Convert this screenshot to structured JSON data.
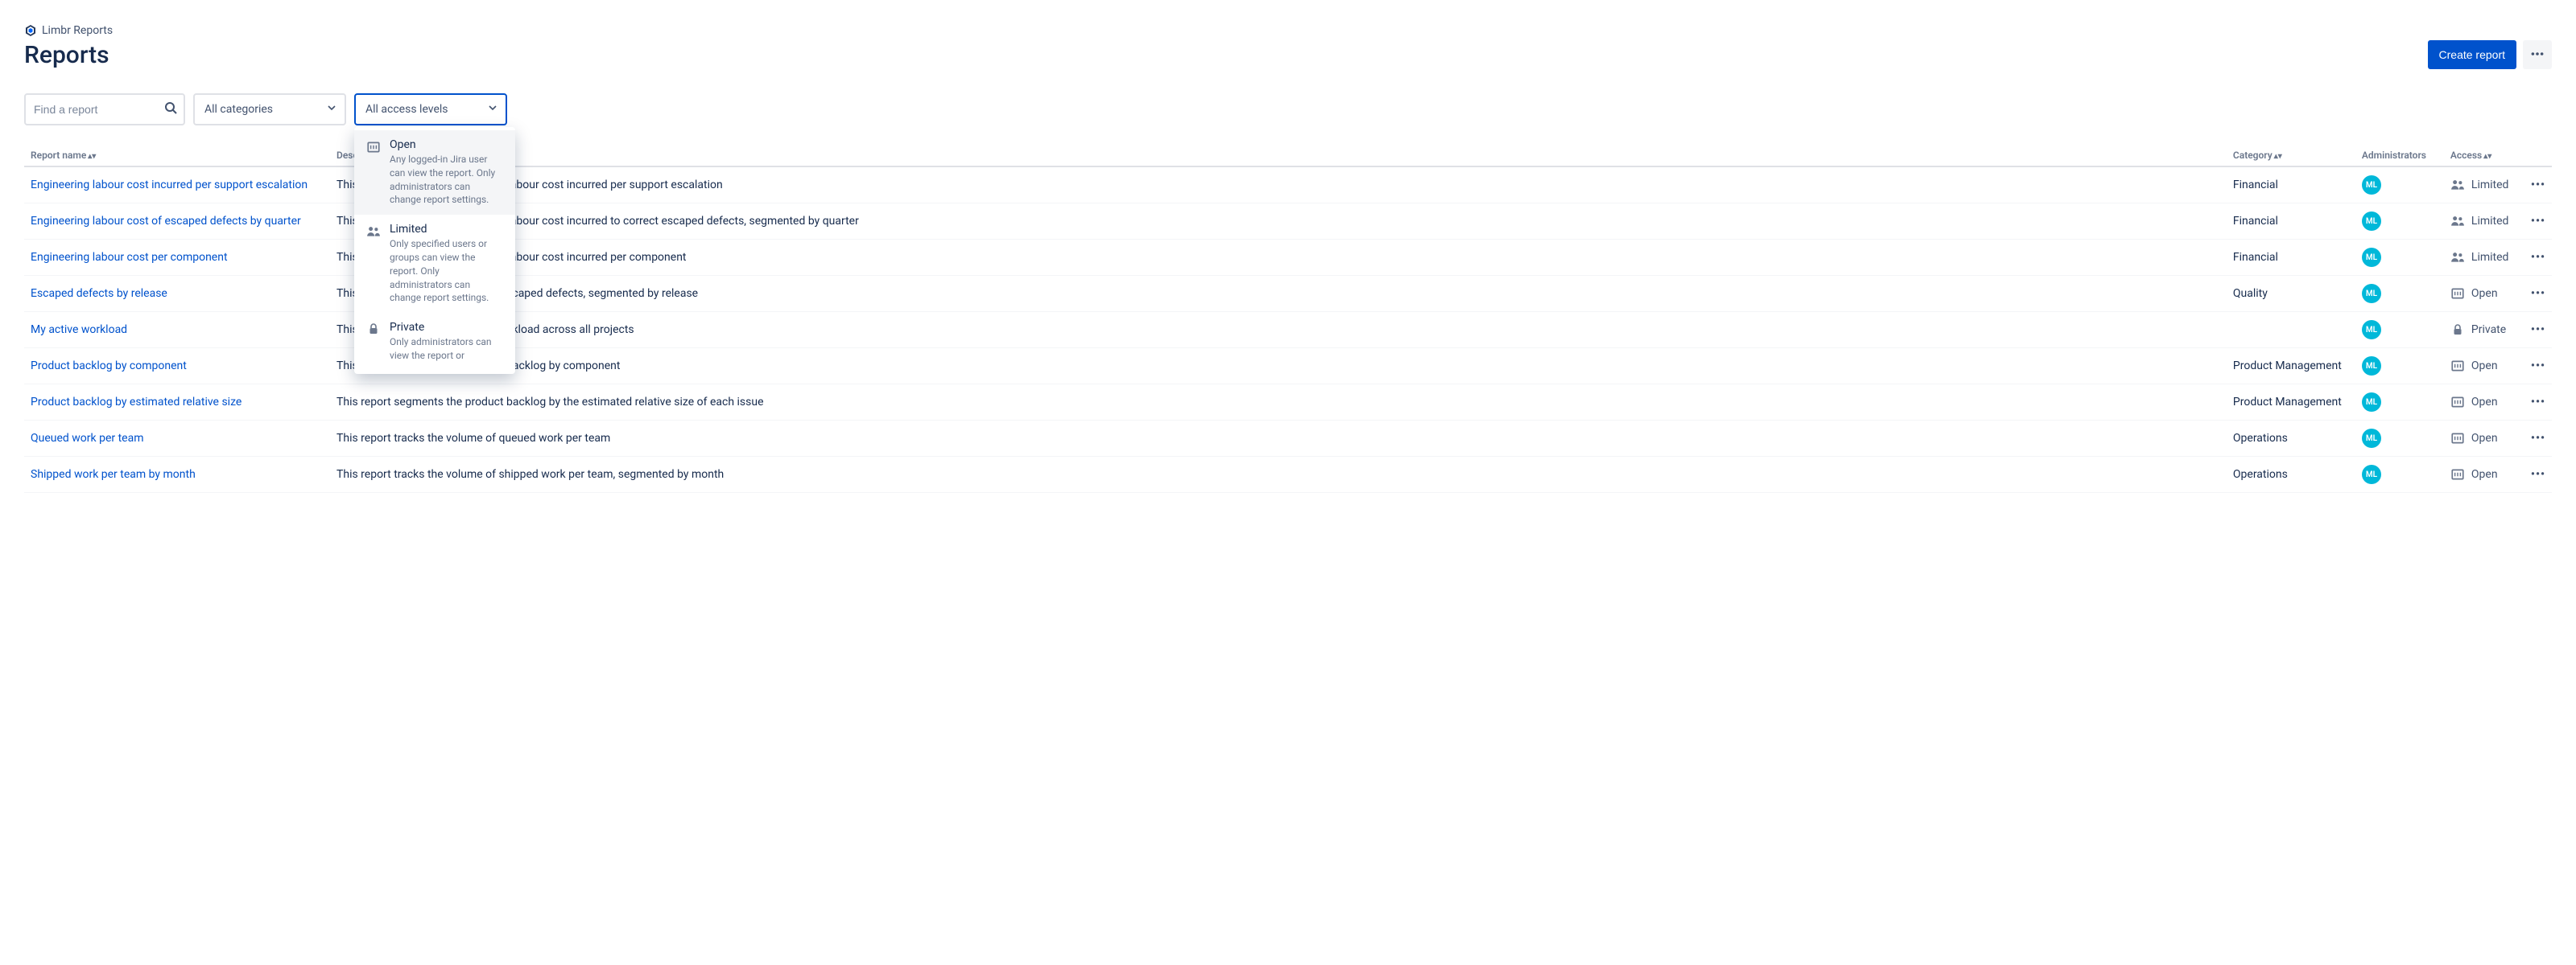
{
  "breadcrumb": {
    "app_name": "Limbr Reports"
  },
  "header": {
    "title": "Reports",
    "create_button": "Create report"
  },
  "filters": {
    "search_placeholder": "Find a report",
    "category_select": "All categories",
    "access_select": "All access levels"
  },
  "access_dropdown": {
    "options": [
      {
        "title": "Open",
        "desc": "Any logged-in Jira user can view the report. Only administrators can change report settings.",
        "icon": "open",
        "selected": true
      },
      {
        "title": "Limited",
        "desc": "Only specified users or groups can view the report. Only administrators can change report settings.",
        "icon": "limited",
        "selected": false
      },
      {
        "title": "Private",
        "desc": "Only administrators can view the report or",
        "icon": "private",
        "selected": false
      }
    ]
  },
  "columns": {
    "name": "Report name",
    "desc": "Description",
    "category": "Category",
    "admins": "Administrators",
    "access": "Access"
  },
  "avatar_initials": "ML",
  "rows": [
    {
      "name": "Engineering labour cost incurred per support escalation",
      "desc": "This report tracks the engineering labour cost incurred per support escalation",
      "category": "Financial",
      "access": "Limited",
      "access_icon": "limited"
    },
    {
      "name": "Engineering labour cost of escaped defects by quarter",
      "desc": "This report tracks the engineering labour cost incurred to correct escaped defects, segmented by quarter",
      "category": "Financial",
      "access": "Limited",
      "access_icon": "limited"
    },
    {
      "name": "Engineering labour cost per component",
      "desc": "This report tracks the engineering labour cost incurred per component",
      "category": "Financial",
      "access": "Limited",
      "access_icon": "limited"
    },
    {
      "name": "Escaped defects by release",
      "desc": "This report tracks the number of escaped defects, segmented by release",
      "category": "Quality",
      "access": "Open",
      "access_icon": "open"
    },
    {
      "name": "My active workload",
      "desc": "This report tracks my assigned workload across all projects",
      "category": "",
      "access": "Private",
      "access_icon": "private"
    },
    {
      "name": "Product backlog by component",
      "desc": "This report segments the product backlog by component",
      "category": "Product Management",
      "access": "Open",
      "access_icon": "open"
    },
    {
      "name": "Product backlog by estimated relative size",
      "desc": "This report segments the product backlog by the estimated relative size of each issue",
      "category": "Product Management",
      "access": "Open",
      "access_icon": "open"
    },
    {
      "name": "Queued work per team",
      "desc": "This report tracks the volume of queued work per team",
      "category": "Operations",
      "access": "Open",
      "access_icon": "open"
    },
    {
      "name": "Shipped work per team by month",
      "desc": "This report tracks the volume of shipped work per team, segmented by month",
      "category": "Operations",
      "access": "Open",
      "access_icon": "open"
    }
  ]
}
